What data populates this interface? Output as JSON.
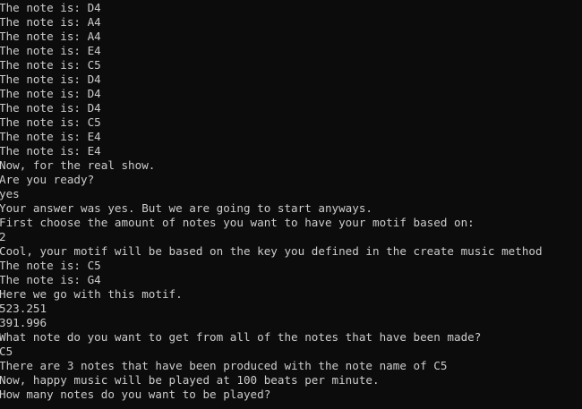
{
  "console": {
    "lines": [
      "The note is: D4",
      "The note is: A4",
      "The note is: A4",
      "The note is: E4",
      "The note is: C5",
      "The note is: D4",
      "The note is: D4",
      "The note is: D4",
      "The note is: C5",
      "The note is: E4",
      "The note is: E4",
      "Now, for the real show.",
      "Are you ready?",
      "yes",
      "Your answer was yes. But we are going to start anyways.",
      "First choose the amount of notes you want to have your motif based on:",
      "2",
      "Cool, your motif will be based on the key you defined in the create music method",
      "The note is: C5",
      "The note is: G4",
      "Here we go with this motif.",
      "523.251",
      "391.996",
      "What note do you want to get from all of the notes that have been made?",
      "C5",
      "There are 3 notes that have been produced with the note name of C5",
      "Now, happy music will be played at 100 beats per minute.",
      "How many notes do you want to be played?"
    ]
  }
}
